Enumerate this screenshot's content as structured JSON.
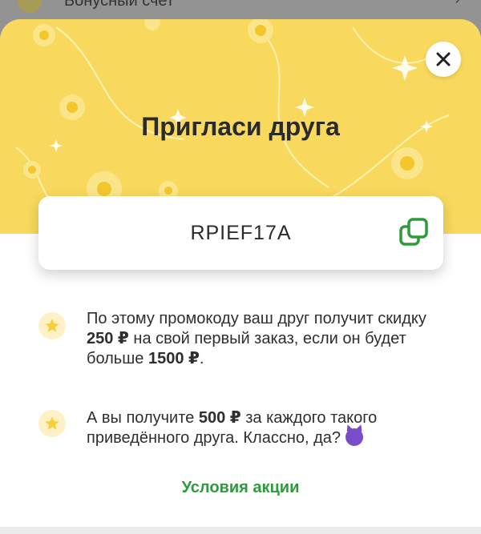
{
  "background_row": {
    "label": "Бонусный счет"
  },
  "modal": {
    "title": "Пригласи друга",
    "close_icon": "close-icon",
    "promo_code": "RPIEF17A",
    "copy_icon": "copy-icon",
    "info_1": {
      "part1": "По этому промокоду ваш друг получит скидку ",
      "amount1": "250 ₽",
      "part2": " на свой первый заказ, если он будет больше ",
      "amount2": "1500 ₽",
      "part3": "."
    },
    "info_2": {
      "part1": "А вы получите ",
      "amount": "500 ₽",
      "part2": " за каждого такого приведённого друга. Классно, да? ",
      "emoji": "devil-emoji"
    },
    "terms_link": "Условия акции"
  },
  "colors": {
    "header_yellow": "#f8d95d",
    "accent_green": "#2e9a3c",
    "copy_icon_green": "#2e9a3c",
    "star_yellow": "#f6cf3a"
  }
}
